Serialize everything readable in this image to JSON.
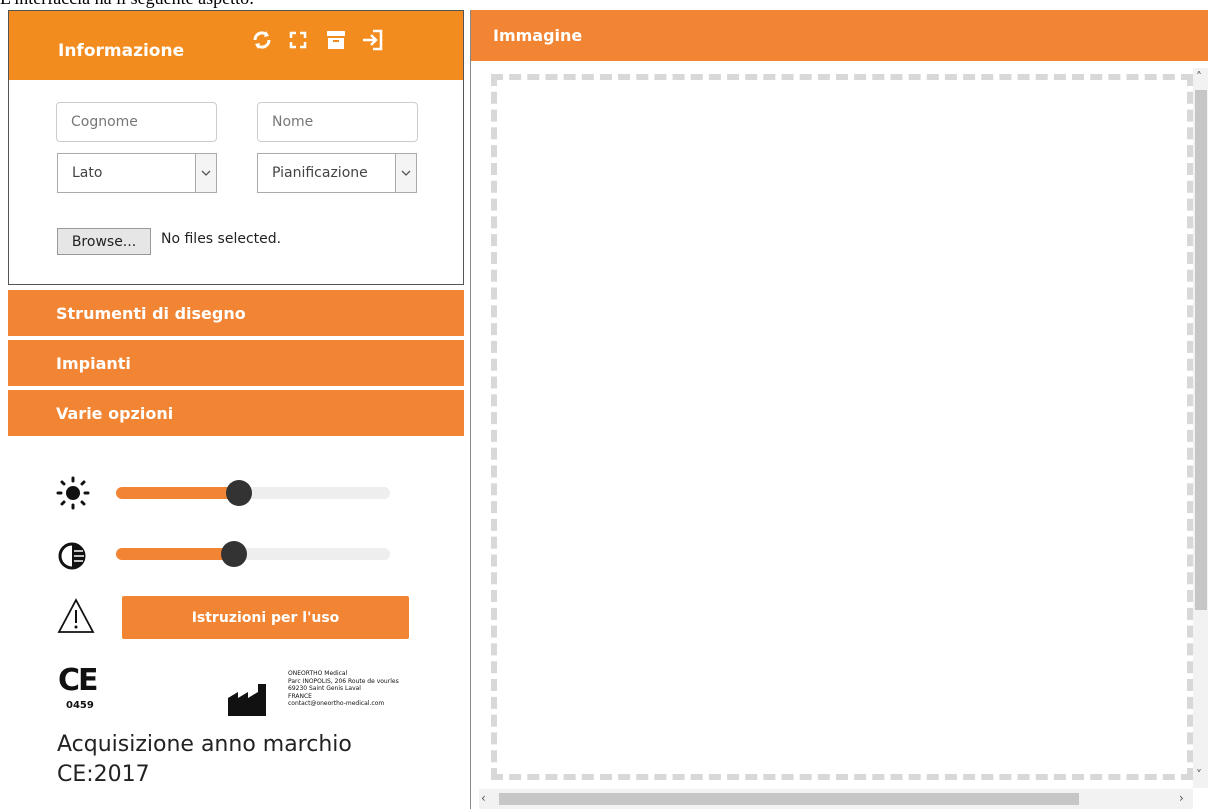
{
  "caption": "L'interfaccia ha il seguente aspetto:",
  "info": {
    "title": "Informazione",
    "header_icons": [
      "refresh-icon",
      "fullscreen-icon",
      "archive-icon",
      "exit-icon"
    ],
    "surname_placeholder": "Cognome",
    "name_placeholder": "Nome",
    "side_select": "Lato",
    "planning_select": "Pianificazione",
    "browse_label": "Browse...",
    "no_files": "No files selected."
  },
  "sections": {
    "drawing_tools": "Strumenti di disegno",
    "implants": "Impianti",
    "options": "Varie opzioni"
  },
  "options": {
    "brightness_level": 0.45,
    "contrast_level": 0.43,
    "instructions_button": "Istruzioni per l'uso",
    "ce_mark": "CE",
    "ce_number": "0459",
    "manufacturer": [
      "ONEORTHO Medical",
      "Parc INOPOLIS, 206 Route de vourles",
      "69230 Saint Genis Laval",
      "FRANCE",
      "contact@oneortho-medical.com"
    ],
    "acquisition_text": "Acquisizione anno marchio CE:2017"
  },
  "image_panel": {
    "title": "Immagine"
  },
  "colors": {
    "accent": "#f28534",
    "accent_dark": "#f28c1e",
    "knob": "#333333"
  }
}
